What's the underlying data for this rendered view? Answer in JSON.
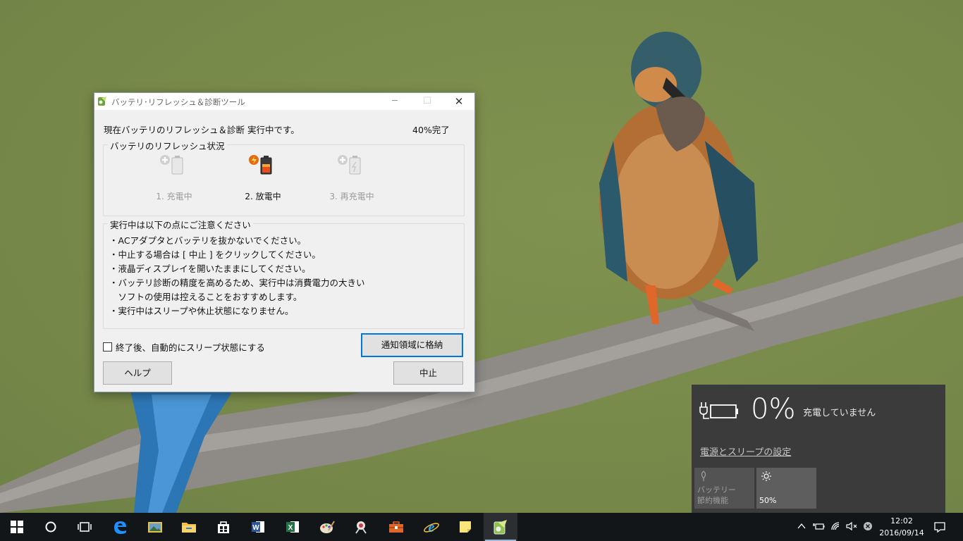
{
  "dialog": {
    "title": "バッテリ･リフレッシュ＆診断ツール",
    "status_line": "現在バッテリのリフレッシュ＆診断 実行中です。",
    "progress_text": "40%完了",
    "progress_value": 40,
    "refresh_group": {
      "legend": "バッテリのリフレッシュ状況",
      "steps": [
        {
          "label": "1. 充電中",
          "state": "inactive",
          "icon": "battery-charge-icon"
        },
        {
          "label": "2. 放電中",
          "state": "active",
          "icon": "battery-discharge-icon"
        },
        {
          "label": "3. 再充電中",
          "state": "inactive",
          "icon": "battery-recharge-icon"
        }
      ]
    },
    "notes_group": {
      "legend": "実行中は以下の点にご注意ください",
      "items": [
        "・ACアダプタとバッテリを抜かないでください。",
        "・中止する場合は [ 中止 ] をクリックしてください。",
        "・液晶ディスプレイを開いたままにしてください。",
        "・バッテリ診断の精度を高めるため、実行中は消費電力の大きい",
        "　ソフトの使用は控えることをおすすめします。",
        "・実行中はスリープや休止状態になりません。"
      ]
    },
    "auto_sleep_label": "終了後、自動的にスリープ状態にする",
    "auto_sleep_checked": false,
    "store_button": "通知領域に格納",
    "help_button": "ヘルプ",
    "stop_button": "中止"
  },
  "battery_flyout": {
    "percent": "0%",
    "status": "充電していません",
    "settings_link": "電源とスリープの設定",
    "tiles": [
      {
        "label_line1": "バッテリー",
        "label_line2": "節約機能",
        "icon": "leaf-icon",
        "enabled": false
      },
      {
        "label_line1": "",
        "label_line2": "50%",
        "icon": "brightness-icon",
        "enabled": true
      }
    ]
  },
  "taskbar": {
    "items": [
      "start-icon",
      "cortana-icon",
      "task-view-icon",
      "edge-icon",
      "photos-icon",
      "file-explorer-icon",
      "store-icon",
      "word-icon",
      "excel-icon",
      "paint-icon",
      "app-icon",
      "toolbox-icon",
      "ie-icon",
      "sticky-notes-icon",
      "battery-tool-icon"
    ],
    "clock_time": "12:02",
    "clock_date": "2016/09/14"
  },
  "colors": {
    "accent": "#0078d7",
    "flyout_bg": "#3b3b3b",
    "taskbar_bg": "#131618",
    "wallpaper": "#7a8d4e"
  }
}
